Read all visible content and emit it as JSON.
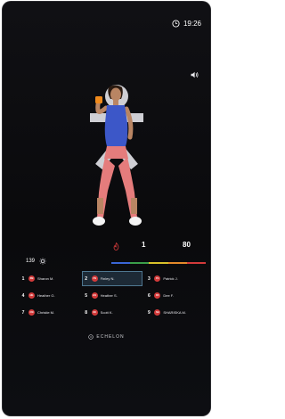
{
  "status": {
    "time": "19:26"
  },
  "stats": [
    {
      "value": "",
      "label": ""
    },
    {
      "value": "1",
      "label": "",
      "unit": ""
    },
    {
      "value": "80",
      "label": "",
      "unit": ""
    }
  ],
  "zone_colors": [
    "#3a66d6",
    "#3a9e4a",
    "#d8c12a",
    "#e48a2a",
    "#d23a3a"
  ],
  "leaderboard": {
    "count": "139",
    "entries": [
      {
        "rank": "1",
        "initials": "SM",
        "name": "Sharon M.",
        "value": "",
        "highlight": false
      },
      {
        "rank": "2",
        "initials": "FN",
        "name": "Finley N.",
        "value": "",
        "highlight": true
      },
      {
        "rank": "3",
        "initials": "PJ",
        "name": "Patrick J.",
        "value": "",
        "highlight": false
      },
      {
        "rank": "4",
        "initials": "HG",
        "name": "Heather G.",
        "value": "",
        "highlight": false
      },
      {
        "rank": "5",
        "initials": "HS",
        "name": "Heather S.",
        "value": "",
        "highlight": false
      },
      {
        "rank": "6",
        "initials": "DF",
        "name": "Dee F.",
        "value": "",
        "highlight": false
      },
      {
        "rank": "7",
        "initials": "CM",
        "name": "Christie M.",
        "value": "",
        "highlight": false
      },
      {
        "rank": "8",
        "initials": "SK",
        "name": "Scott K.",
        "value": "",
        "highlight": false
      },
      {
        "rank": "9",
        "initials": "SH",
        "name": "SHARISKA M.",
        "value": "",
        "highlight": false
      }
    ]
  },
  "brand": {
    "logo_text": "ECHELON"
  },
  "icons": {
    "clock": "clock-icon",
    "trainer": "trainer-icon",
    "volume": "volume-icon",
    "calories": "flame-icon",
    "settings": "gear-icon"
  }
}
